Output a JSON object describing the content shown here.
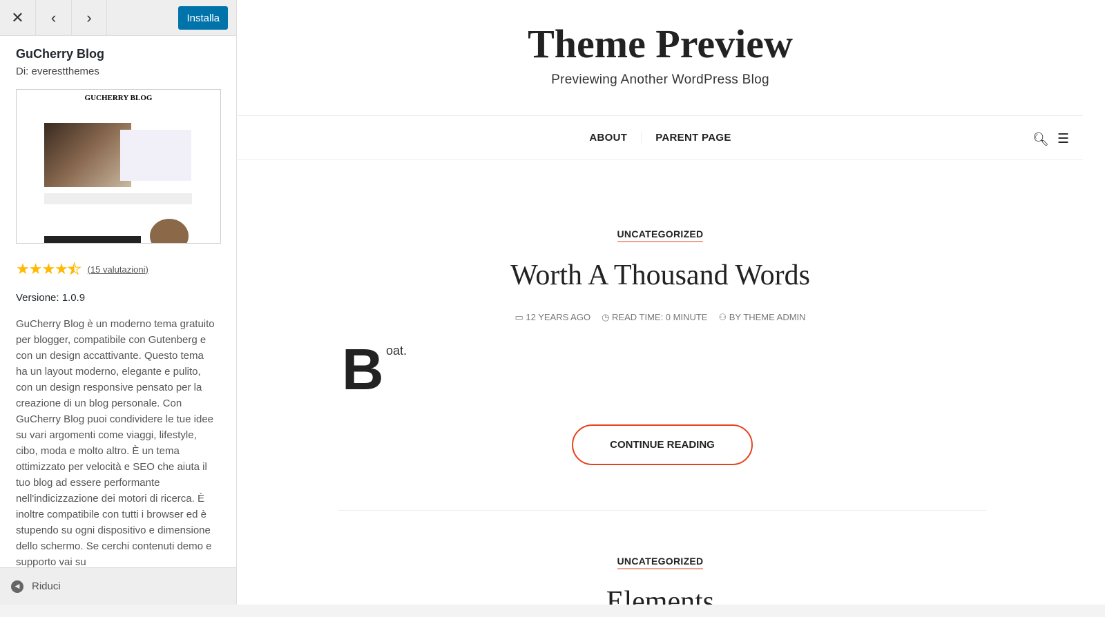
{
  "sidebar": {
    "install_label": "Installa",
    "theme_name": "GuCherry Blog",
    "author": "Di: everestthemes",
    "thumbnail_logo": "GUCHERRY BLOG",
    "rating": 4.5,
    "rating_count": "(15 valutazioni)",
    "version": "Versione: 1.0.9",
    "description": "GuCherry Blog è un moderno tema gratuito per blogger, compatibile con Gutenberg e con un design accattivante. Questo tema ha un layout moderno, elegante e pulito, con un design responsive pensato per la creazione di un blog personale. Con GuCherry Blog puoi condividere le tue idee su vari argomenti come viaggi, lifestyle, cibo, moda e molto altro. È un tema ottimizzato per velocità e SEO che aiuta il tuo blog ad essere performante nell'indicizzazione dei motori di ricerca. È inoltre compatibile con tutti i browser ed è stupendo su ogni dispositivo e dimensione dello schermo. Se cerchi contenuti demo e supporto vai su",
    "collapse_label": "Riduci",
    "accent": "#0073aa"
  },
  "site": {
    "title": "Theme Preview",
    "tagline": "Previewing Another WordPress Blog",
    "nav": [
      "ABOUT",
      "PARENT PAGE"
    ]
  },
  "posts": [
    {
      "category": "UNCATEGORIZED",
      "title": "Worth A Thousand Words",
      "date": "12 YEARS AGO",
      "read_time": "READ TIME: 0 MINUTE",
      "author": "BY THEME ADMIN",
      "dropcap": "B",
      "excerpt": "oat.",
      "button": "CONTINUE READING"
    },
    {
      "category": "UNCATEGORIZED",
      "title": "Elements"
    }
  ],
  "colors": {
    "button_border": "#e8401c",
    "star": "#ffb900"
  }
}
